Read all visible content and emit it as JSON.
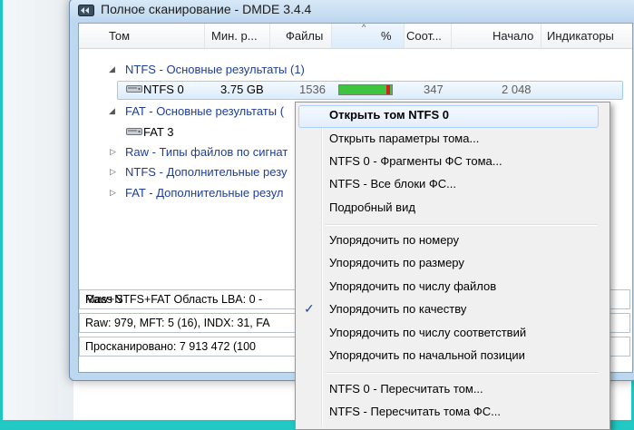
{
  "window": {
    "title": "Полное сканирование - DMDE 3.4.4"
  },
  "columns": [
    "Том",
    "Мин. р...",
    "Файлы",
    "%",
    "Соот...",
    "Начало",
    "Индикаторы"
  ],
  "tree": {
    "groups": [
      {
        "label": "NTFS - Основные результаты (1)",
        "expanded": true
      },
      {
        "label": "FAT - Основные результаты (",
        "expanded": true
      },
      {
        "label": "Raw - Типы файлов по сигнат",
        "expanded": false
      },
      {
        "label": "NTFS - Дополнительные резу",
        "expanded": false
      },
      {
        "label": "FAT - Дополнительные резул",
        "expanded": false
      }
    ],
    "volumes": [
      {
        "name": "NTFS 0",
        "size": "3.75 GB",
        "files": "1536",
        "quality_fraction": 0.92,
        "matches": "347",
        "start": "2 048",
        "selected": true
      },
      {
        "name": "FAT 3",
        "selected": false
      }
    ]
  },
  "status": {
    "line1": "Raw+NTFS+FAT Область LBA: 0 -",
    "line1_right": "Mass S",
    "line2": "Raw: 979, MFT: 5 (16), INDX: 31, FA",
    "line3": "Просканировано: 7 913 472 (100"
  },
  "context_menu": {
    "items": [
      {
        "label": "Открыть том NTFS 0",
        "bold": true,
        "highlighted": true
      },
      {
        "label": "Открыть параметры тома..."
      },
      {
        "label": "NTFS 0 - Фрагменты ФС тома..."
      },
      {
        "label": "NTFS - Все блоки ФС..."
      },
      {
        "label": "Подробный вид"
      },
      {
        "label": "Упорядочить по номеру"
      },
      {
        "label": "Упорядочить по размеру"
      },
      {
        "label": "Упорядочить по числу файлов"
      },
      {
        "label": "Упорядочить по качеству",
        "checked": true
      },
      {
        "label": "Упорядочить по числу соответствий"
      },
      {
        "label": "Упорядочить по начальной позиции"
      },
      {
        "label": "NTFS 0 - Пересчитать том..."
      },
      {
        "label": "NTFS - Пересчитать тома ФС..."
      }
    ],
    "check_glyph": "✓"
  },
  "colors": {
    "frame": "#1fc6c2",
    "group_text": "#1e3e9a",
    "quality_bar": "#3fc43f",
    "quality_mark": "#d32020"
  }
}
